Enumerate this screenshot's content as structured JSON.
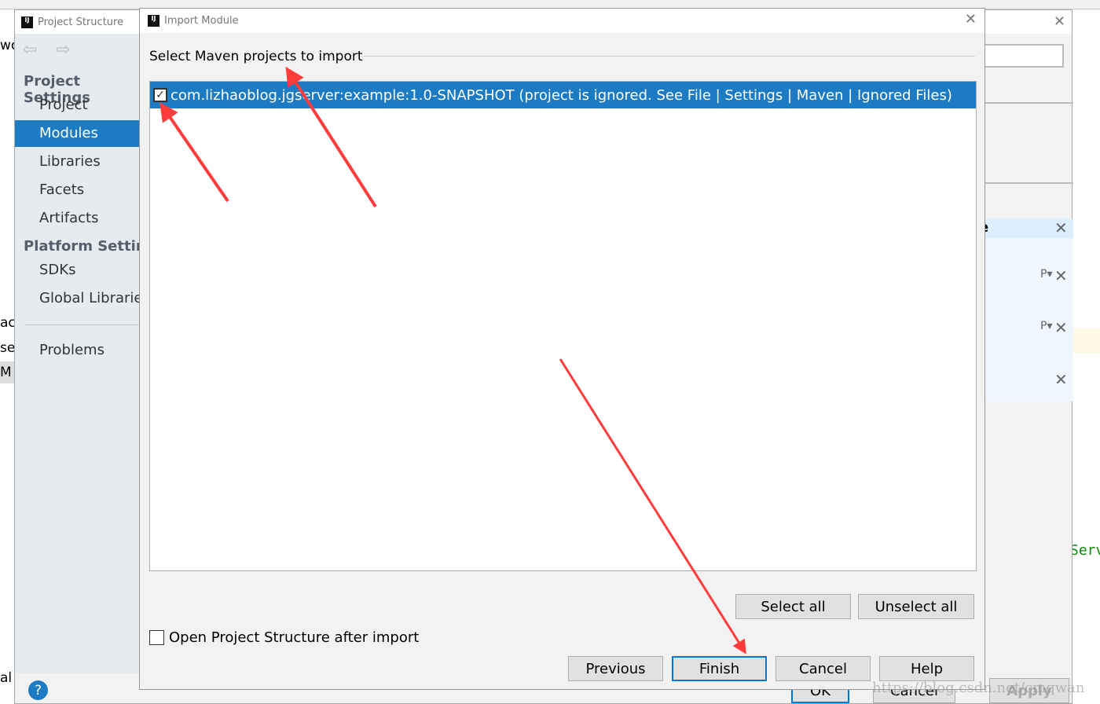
{
  "ide": {
    "left_fragments": [
      "wo",
      "ac",
      "se",
      "M",
      "al"
    ],
    "right_fragment": "Serv"
  },
  "project_structure": {
    "title": "Project Structure",
    "sidebar": {
      "section1": "Project Settings",
      "items1": [
        "Project",
        "Modules",
        "Libraries",
        "Facets",
        "Artifacts"
      ],
      "section2": "Platform Settings",
      "items2": [
        "SDKs",
        "Global Libraries"
      ],
      "problems": "Problems",
      "selected": "Modules"
    },
    "right_fragment": "e",
    "buttons": {
      "ok": "OK",
      "cancel": "Cancel",
      "apply": "Apply"
    },
    "help_icon": "?"
  },
  "import_module": {
    "title": "Import Module",
    "heading": "Select Maven projects to import",
    "projects": [
      {
        "label": "com.lizhaoblog.jgserver:example:1.0-SNAPSHOT (project is ignored. See File | Settings | Maven | Ignored Files)",
        "checked": true
      }
    ],
    "select_all": "Select all",
    "unselect_all": "Unselect all",
    "open_structure_label": "Open Project Structure after import",
    "open_structure_checked": false,
    "buttons": {
      "previous": "Previous",
      "finish": "Finish",
      "cancel": "Cancel",
      "help": "Help"
    }
  },
  "watermark": "https://blog.csdn.net/cmqwan",
  "colors": {
    "selection": "#1c7bc3",
    "annotation_arrow": "#ff3b3b",
    "default_button_border": "#0078d7"
  }
}
